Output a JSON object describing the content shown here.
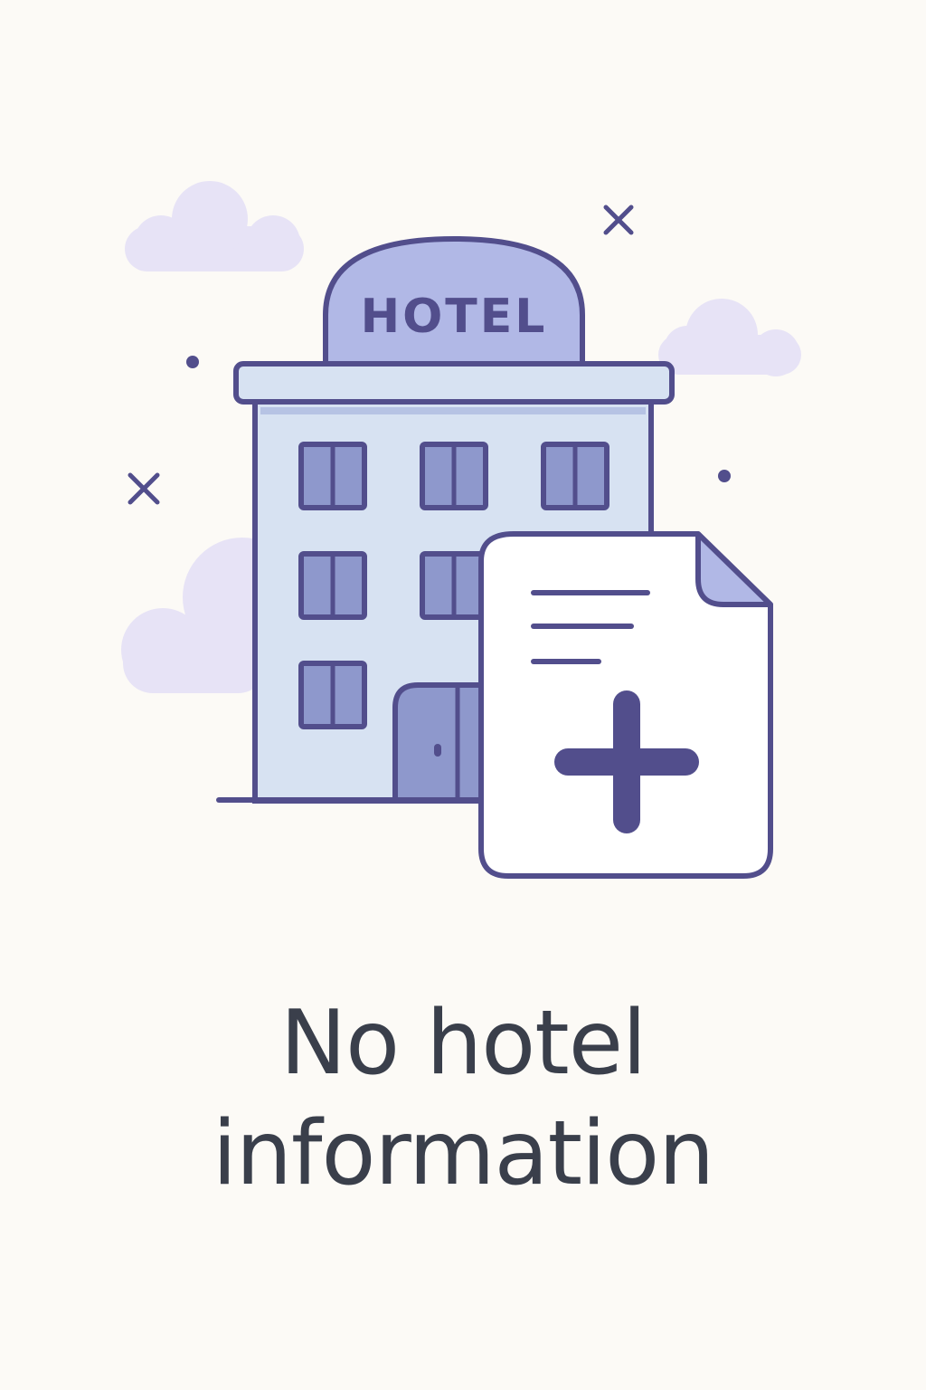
{
  "empty_state": {
    "sign_text": "HOTEL",
    "message_line_1": "No hotel",
    "message_line_2": "information",
    "icons": {
      "building": "hotel-building-icon",
      "document": "add-document-icon",
      "add": "plus-icon",
      "decorations": [
        "cloud-icon",
        "sparkle-x-icon",
        "dot-icon"
      ]
    }
  },
  "colors": {
    "background": "#fcfaf6",
    "outline": "#524e8c",
    "building_fill": "#d7e2f2",
    "window_fill": "#8e98cc",
    "sign_fill": "#b1b8e6",
    "cloud_fill": "#e7e3f6",
    "document_fill": "#ffffff",
    "text": "#3a3f4b"
  }
}
